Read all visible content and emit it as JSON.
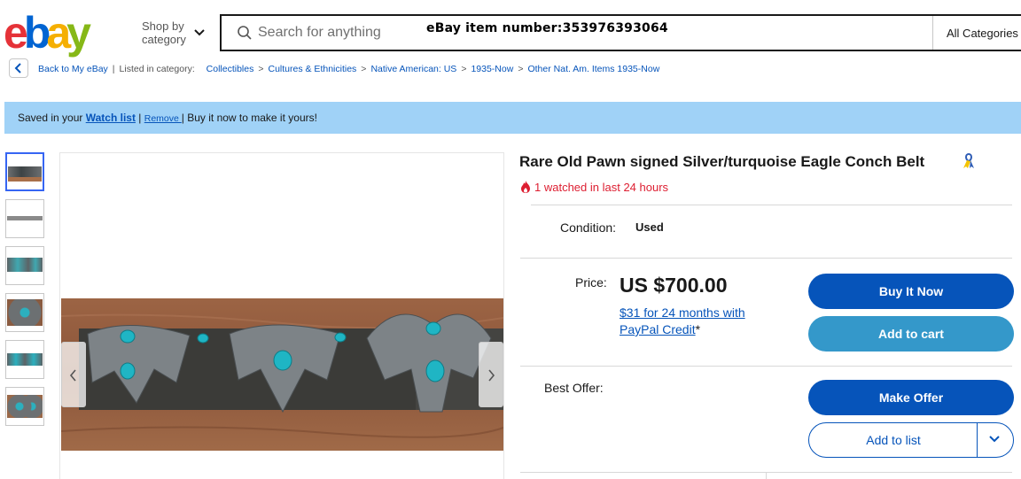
{
  "header": {
    "logo_letters": [
      "e",
      "b",
      "a",
      "y"
    ],
    "shop_by_line1": "Shop by",
    "shop_by_line2": "category",
    "search_placeholder": "Search for anything",
    "item_number_overlay": "eBay item number:353976393064",
    "category_select": "All Categories"
  },
  "breadcrumb": {
    "back_label": "Back to My eBay",
    "listed_in": "Listed in category:",
    "items": [
      "Collectibles",
      "Cultures & Ethnicities",
      "Native American: US",
      "1935-Now",
      "Other Nat. Am. Items 1935-Now"
    ]
  },
  "banner": {
    "saved_prefix": "Saved in your ",
    "watch_list_link": "Watch list",
    "separator": " | ",
    "remove_link": "Remove ",
    "suffix": "| Buy it now to make it yours!"
  },
  "listing": {
    "title": "Rare Old Pawn signed Silver/turquoise Eagle Conch Belt",
    "watched": "1 watched in last 24 hours",
    "condition_label": "Condition:",
    "condition_value": "Used",
    "price_label": "Price:",
    "price_value": "US $700.00",
    "financing_line1": "$31 for 24 months with",
    "financing_line2_link": "PayPal Credit",
    "financing_line2_suffix": "*",
    "best_offer_label": "Best Offer:"
  },
  "buttons": {
    "buy_now": "Buy It Now",
    "add_to_cart": "Add to cart",
    "make_offer": "Make Offer",
    "add_to_list": "Add to list"
  },
  "colors": {
    "logo_e": "#e53238",
    "logo_b": "#0064d2",
    "logo_a": "#f5af02",
    "logo_y": "#86b817",
    "link": "#0654ba",
    "banner": "#a0d2f7",
    "alert": "#dd1e31",
    "primary_button": "#0654ba",
    "secondary_button": "#3498ca",
    "turquoise": "#1fb5c4"
  },
  "icons": {
    "search": "search-icon",
    "chevron": "chevron-down-icon",
    "back": "chevron-left-icon",
    "fire": "fire-icon",
    "ribbon": "ribbon-icon"
  }
}
